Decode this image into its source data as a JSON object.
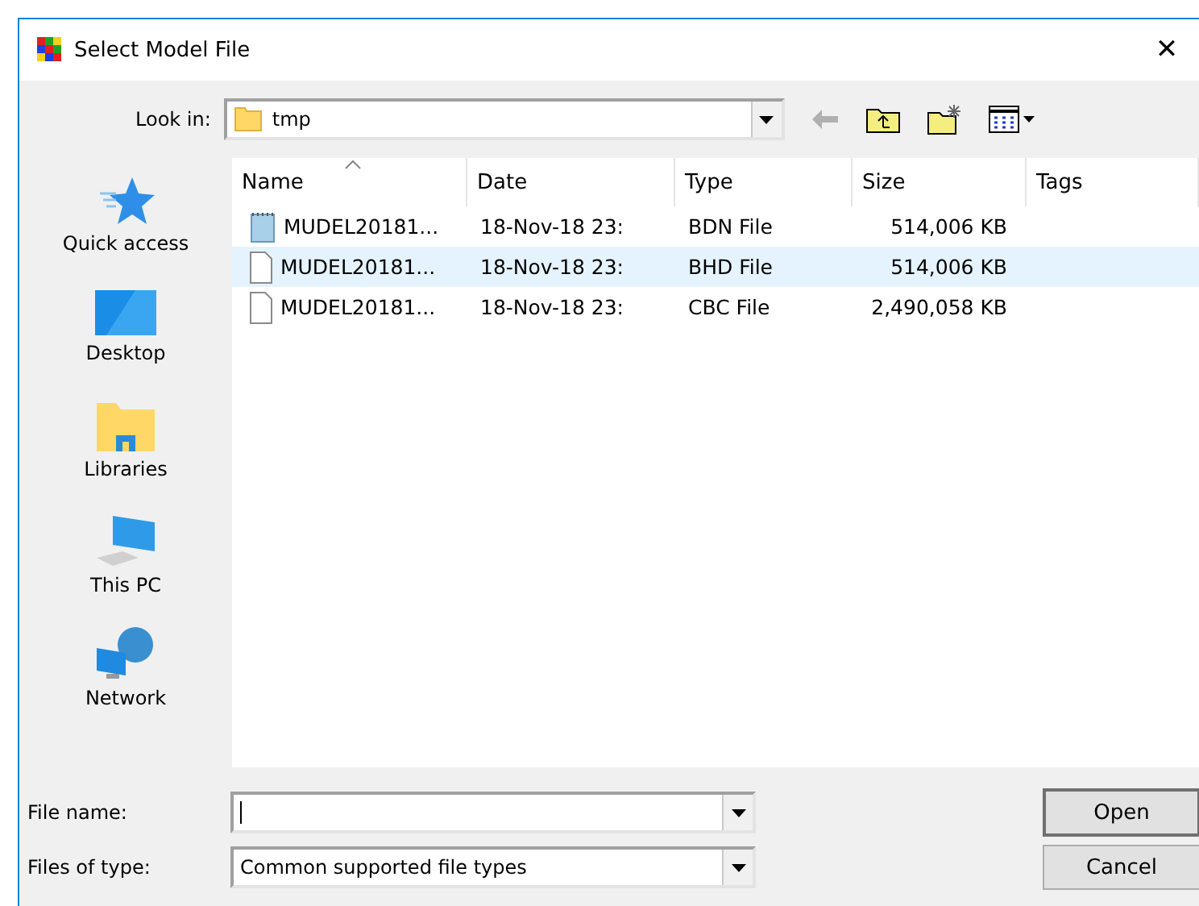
{
  "window": {
    "title": "Select Model File",
    "close": "✕"
  },
  "look_in": {
    "label": "Look in:",
    "value": "tmp"
  },
  "places": [
    {
      "label": "Quick access",
      "kind": "star"
    },
    {
      "label": "Desktop",
      "kind": "desktop"
    },
    {
      "label": "Libraries",
      "kind": "libraries"
    },
    {
      "label": "This PC",
      "kind": "pc"
    },
    {
      "label": "Network",
      "kind": "network"
    }
  ],
  "table": {
    "columns": [
      "Name",
      "Date",
      "Type",
      "Size",
      "Tags"
    ],
    "rows": [
      {
        "name": "MUDEL20181...",
        "date": "18-Nov-18 23:",
        "type": "BDN File",
        "size": "514,006 KB",
        "kind": "notepad",
        "selected": false
      },
      {
        "name": "MUDEL20181...",
        "date": "18-Nov-18 23:",
        "type": "BHD File",
        "size": "514,006 KB",
        "kind": "file",
        "selected": true
      },
      {
        "name": "MUDEL20181...",
        "date": "18-Nov-18 23:",
        "type": "CBC File",
        "size": "2,490,058 KB",
        "kind": "file",
        "selected": false
      }
    ]
  },
  "file_name": {
    "label": "File name:"
  },
  "file_type": {
    "label": "Files of type:",
    "value": "Common supported file types"
  },
  "buttons": [
    {
      "label": "Open",
      "default": true
    },
    {
      "label": "Cancel",
      "default": false
    }
  ]
}
